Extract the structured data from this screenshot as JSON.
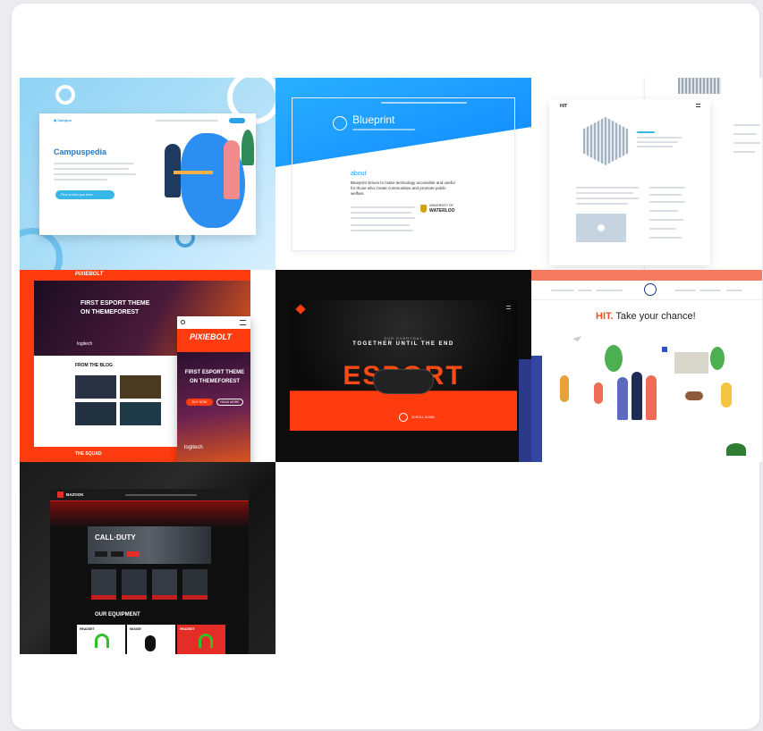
{
  "gallery": {
    "tiles": [
      {
        "app_title": "Campuspedia",
        "cta": "Find a club you love"
      },
      {
        "brand": "Blueprint",
        "about_heading": "about",
        "about_text": "Blueprint strives to make technology accessible and useful for those who create communities and promote public welfare.",
        "partner": "WATERLOO",
        "partner_sub": "UNIVERSITY OF"
      },
      {
        "brand": "HIT"
      },
      {
        "brand": "PIXIEBOLT",
        "hero_line1": "FIRST ESPORT THEME",
        "hero_line2": "ON THEMEFOREST",
        "blog_heading": "FROM THE BLOG",
        "squad": "THE SQUAD",
        "sponsor": "logitech",
        "mobile_buy": "BUY NOW",
        "mobile_read": "READ MORE"
      },
      {
        "subtitle": "OUR EVERYDAY",
        "tagline": "TOGETHER UNTIL THE END",
        "big_word": "ESPORT",
        "nav_text": "SCROLL DOWN"
      },
      {
        "headline_accent": "HIT.",
        "headline_rest": "Take your chance!"
      },
      {
        "brand": "BAZOOK",
        "game_title": "CALL·DUTY",
        "equipment_heading": "OUR EQUIPMENT",
        "products": [
          "HEADSET",
          "MOUSE",
          "HEADSET"
        ]
      }
    ]
  },
  "colors": {
    "accent_red": "#ff3b10",
    "campus_blue": "#2aa1e6",
    "blueprint_blue": "#1a9dff"
  }
}
